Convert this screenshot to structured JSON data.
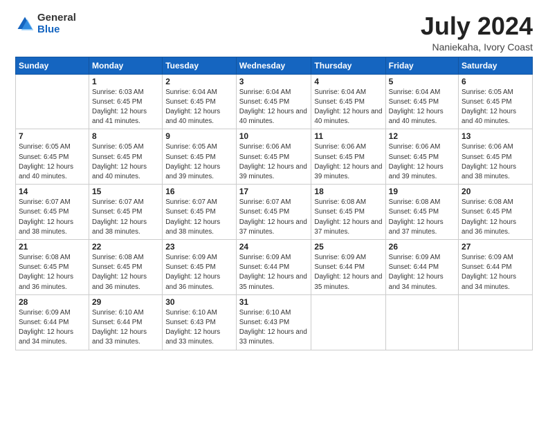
{
  "header": {
    "logo_general": "General",
    "logo_blue": "Blue",
    "month_title": "July 2024",
    "location": "Naniekaha, Ivory Coast"
  },
  "days_of_week": [
    "Sunday",
    "Monday",
    "Tuesday",
    "Wednesday",
    "Thursday",
    "Friday",
    "Saturday"
  ],
  "weeks": [
    [
      {
        "day": "",
        "sunrise": "",
        "sunset": "",
        "daylight": ""
      },
      {
        "day": "1",
        "sunrise": "Sunrise: 6:03 AM",
        "sunset": "Sunset: 6:45 PM",
        "daylight": "Daylight: 12 hours and 41 minutes."
      },
      {
        "day": "2",
        "sunrise": "Sunrise: 6:04 AM",
        "sunset": "Sunset: 6:45 PM",
        "daylight": "Daylight: 12 hours and 40 minutes."
      },
      {
        "day": "3",
        "sunrise": "Sunrise: 6:04 AM",
        "sunset": "Sunset: 6:45 PM",
        "daylight": "Daylight: 12 hours and 40 minutes."
      },
      {
        "day": "4",
        "sunrise": "Sunrise: 6:04 AM",
        "sunset": "Sunset: 6:45 PM",
        "daylight": "Daylight: 12 hours and 40 minutes."
      },
      {
        "day": "5",
        "sunrise": "Sunrise: 6:04 AM",
        "sunset": "Sunset: 6:45 PM",
        "daylight": "Daylight: 12 hours and 40 minutes."
      },
      {
        "day": "6",
        "sunrise": "Sunrise: 6:05 AM",
        "sunset": "Sunset: 6:45 PM",
        "daylight": "Daylight: 12 hours and 40 minutes."
      }
    ],
    [
      {
        "day": "7",
        "sunrise": "Sunrise: 6:05 AM",
        "sunset": "Sunset: 6:45 PM",
        "daylight": "Daylight: 12 hours and 40 minutes."
      },
      {
        "day": "8",
        "sunrise": "Sunrise: 6:05 AM",
        "sunset": "Sunset: 6:45 PM",
        "daylight": "Daylight: 12 hours and 40 minutes."
      },
      {
        "day": "9",
        "sunrise": "Sunrise: 6:05 AM",
        "sunset": "Sunset: 6:45 PM",
        "daylight": "Daylight: 12 hours and 39 minutes."
      },
      {
        "day": "10",
        "sunrise": "Sunrise: 6:06 AM",
        "sunset": "Sunset: 6:45 PM",
        "daylight": "Daylight: 12 hours and 39 minutes."
      },
      {
        "day": "11",
        "sunrise": "Sunrise: 6:06 AM",
        "sunset": "Sunset: 6:45 PM",
        "daylight": "Daylight: 12 hours and 39 minutes."
      },
      {
        "day": "12",
        "sunrise": "Sunrise: 6:06 AM",
        "sunset": "Sunset: 6:45 PM",
        "daylight": "Daylight: 12 hours and 39 minutes."
      },
      {
        "day": "13",
        "sunrise": "Sunrise: 6:06 AM",
        "sunset": "Sunset: 6:45 PM",
        "daylight": "Daylight: 12 hours and 38 minutes."
      }
    ],
    [
      {
        "day": "14",
        "sunrise": "Sunrise: 6:07 AM",
        "sunset": "Sunset: 6:45 PM",
        "daylight": "Daylight: 12 hours and 38 minutes."
      },
      {
        "day": "15",
        "sunrise": "Sunrise: 6:07 AM",
        "sunset": "Sunset: 6:45 PM",
        "daylight": "Daylight: 12 hours and 38 minutes."
      },
      {
        "day": "16",
        "sunrise": "Sunrise: 6:07 AM",
        "sunset": "Sunset: 6:45 PM",
        "daylight": "Daylight: 12 hours and 38 minutes."
      },
      {
        "day": "17",
        "sunrise": "Sunrise: 6:07 AM",
        "sunset": "Sunset: 6:45 PM",
        "daylight": "Daylight: 12 hours and 37 minutes."
      },
      {
        "day": "18",
        "sunrise": "Sunrise: 6:08 AM",
        "sunset": "Sunset: 6:45 PM",
        "daylight": "Daylight: 12 hours and 37 minutes."
      },
      {
        "day": "19",
        "sunrise": "Sunrise: 6:08 AM",
        "sunset": "Sunset: 6:45 PM",
        "daylight": "Daylight: 12 hours and 37 minutes."
      },
      {
        "day": "20",
        "sunrise": "Sunrise: 6:08 AM",
        "sunset": "Sunset: 6:45 PM",
        "daylight": "Daylight: 12 hours and 36 minutes."
      }
    ],
    [
      {
        "day": "21",
        "sunrise": "Sunrise: 6:08 AM",
        "sunset": "Sunset: 6:45 PM",
        "daylight": "Daylight: 12 hours and 36 minutes."
      },
      {
        "day": "22",
        "sunrise": "Sunrise: 6:08 AM",
        "sunset": "Sunset: 6:45 PM",
        "daylight": "Daylight: 12 hours and 36 minutes."
      },
      {
        "day": "23",
        "sunrise": "Sunrise: 6:09 AM",
        "sunset": "Sunset: 6:45 PM",
        "daylight": "Daylight: 12 hours and 36 minutes."
      },
      {
        "day": "24",
        "sunrise": "Sunrise: 6:09 AM",
        "sunset": "Sunset: 6:44 PM",
        "daylight": "Daylight: 12 hours and 35 minutes."
      },
      {
        "day": "25",
        "sunrise": "Sunrise: 6:09 AM",
        "sunset": "Sunset: 6:44 PM",
        "daylight": "Daylight: 12 hours and 35 minutes."
      },
      {
        "day": "26",
        "sunrise": "Sunrise: 6:09 AM",
        "sunset": "Sunset: 6:44 PM",
        "daylight": "Daylight: 12 hours and 34 minutes."
      },
      {
        "day": "27",
        "sunrise": "Sunrise: 6:09 AM",
        "sunset": "Sunset: 6:44 PM",
        "daylight": "Daylight: 12 hours and 34 minutes."
      }
    ],
    [
      {
        "day": "28",
        "sunrise": "Sunrise: 6:09 AM",
        "sunset": "Sunset: 6:44 PM",
        "daylight": "Daylight: 12 hours and 34 minutes."
      },
      {
        "day": "29",
        "sunrise": "Sunrise: 6:10 AM",
        "sunset": "Sunset: 6:44 PM",
        "daylight": "Daylight: 12 hours and 33 minutes."
      },
      {
        "day": "30",
        "sunrise": "Sunrise: 6:10 AM",
        "sunset": "Sunset: 6:43 PM",
        "daylight": "Daylight: 12 hours and 33 minutes."
      },
      {
        "day": "31",
        "sunrise": "Sunrise: 6:10 AM",
        "sunset": "Sunset: 6:43 PM",
        "daylight": "Daylight: 12 hours and 33 minutes."
      },
      {
        "day": "",
        "sunrise": "",
        "sunset": "",
        "daylight": ""
      },
      {
        "day": "",
        "sunrise": "",
        "sunset": "",
        "daylight": ""
      },
      {
        "day": "",
        "sunrise": "",
        "sunset": "",
        "daylight": ""
      }
    ]
  ]
}
